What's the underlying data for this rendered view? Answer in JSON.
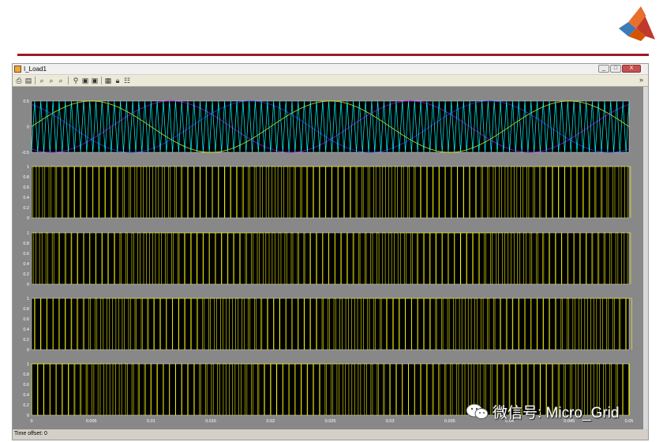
{
  "window": {
    "title": "I_Load1",
    "time_offset_label": "Time offset:",
    "time_offset_value": "0",
    "buttons": {
      "minimize": "_",
      "maximize": "□",
      "close": "X"
    },
    "toolbar_right": "»"
  },
  "toolbar": {
    "icons": [
      "print-icon",
      "parameters-icon",
      "zoom-in-icon",
      "zoom-x-icon",
      "zoom-y-icon",
      "autoscale-icon",
      "save-axes-icon",
      "restore-axes-icon",
      "floating-scope-icon",
      "lock-icon",
      "signal-selection-icon"
    ]
  },
  "watermark": {
    "text": "微信号: Micro_Grid"
  },
  "colors": {
    "plot_bg": "#000000",
    "frame_bg": "#888888",
    "cyan": "#00ffff",
    "yellow": "#ffff00",
    "magenta": "#c000ff",
    "blue": "#3a3aff",
    "accent_red": "#9b1b25"
  },
  "chart_data": {
    "type": "line",
    "x_ticks": [
      "0",
      "0.005",
      "0.01",
      "0.015",
      "0.02",
      "0.025",
      "0.03",
      "0.035",
      "0.04",
      "0.045",
      "0.05"
    ],
    "xlim": [
      0,
      0.05
    ],
    "axes": [
      {
        "ylim": [
          -0.5,
          0.5
        ],
        "y_ticks": [
          "0.5",
          "0",
          "-0.5"
        ],
        "series": [
          {
            "color": "#ffff00",
            "kind": "sine",
            "amplitude": 0.5,
            "frequency": 50,
            "phase_deg": 0
          },
          {
            "color": "#c000ff",
            "kind": "sine",
            "amplitude": 0.5,
            "frequency": 50,
            "phase_deg": -120
          },
          {
            "color": "#3a3aff",
            "kind": "sine",
            "amplitude": 0.5,
            "frequency": 50,
            "phase_deg": 120
          },
          {
            "color": "#00ffff",
            "kind": "carrier",
            "amplitude": 0.5,
            "frequency": 1950
          }
        ]
      },
      {
        "ylim": [
          0,
          1
        ],
        "y_ticks": [
          "1",
          "0.8",
          "0.6",
          "0.4",
          "0.2",
          "0"
        ],
        "series": [
          {
            "color": "#ffff00",
            "kind": "pwm",
            "phase_deg": 0
          }
        ]
      },
      {
        "ylim": [
          0,
          1
        ],
        "y_ticks": [
          "1",
          "0.8",
          "0.6",
          "0.4",
          "0.2",
          "0"
        ],
        "series": [
          {
            "color": "#ffff00",
            "kind": "pwm",
            "phase_deg": 180
          }
        ]
      },
      {
        "ylim": [
          0,
          1
        ],
        "y_ticks": [
          "1",
          "0.8",
          "0.6",
          "0.4",
          "0.2",
          "0"
        ],
        "series": [
          {
            "color": "#ffff00",
            "kind": "pwm",
            "phase_deg": -120
          }
        ]
      },
      {
        "ylim": [
          0,
          1
        ],
        "y_ticks": [
          "1",
          "0.8",
          "0.6",
          "0.4",
          "0.2",
          "0"
        ],
        "series": [
          {
            "color": "#ffff00",
            "kind": "pwm",
            "phase_deg": 60
          }
        ]
      }
    ]
  }
}
